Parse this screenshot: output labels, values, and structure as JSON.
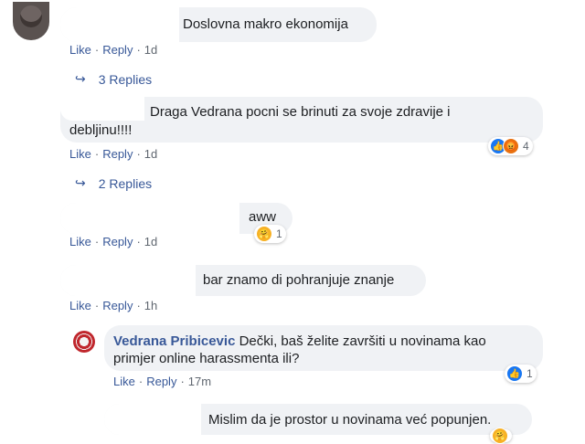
{
  "comments": [
    {
      "text": "Doslovna makro ekonomija",
      "actions": {
        "like": "Like",
        "reply": "Reply",
        "time": "1d"
      },
      "replies_label": "3 Replies"
    },
    {
      "text_line1": "Draga Vedrana pocni se brinuti za svoje zdravije i",
      "text_line2": "debljinu!!!!",
      "reaction_count": "4",
      "actions": {
        "like": "Like",
        "reply": "Reply",
        "time": "1d"
      },
      "replies_label": "2 Replies"
    },
    {
      "text": "aww",
      "reaction_count": "1",
      "actions": {
        "like": "Like",
        "reply": "Reply",
        "time": "1d"
      }
    },
    {
      "text": "bar znamo di pohranjuje znanje",
      "actions": {
        "like": "Like",
        "reply": "Reply",
        "time": "1h"
      }
    },
    {
      "author": "Vedrana Pribicevic",
      "text_line1": "Dečki, baš želite završiti u novinama kao",
      "text_line2": "primjer online harassmenta ili?",
      "reaction_count": "1",
      "actions": {
        "like": "Like",
        "reply": "Reply",
        "time": "17m"
      }
    },
    {
      "text": "Mislim da je prostor u novinama već popunjen."
    }
  ],
  "icons": {
    "reply_arrow": "reply-arrow-icon",
    "like_reaction": "like-reaction-icon",
    "angry_reaction": "angry-reaction-icon",
    "care_reaction": "care-reaction-icon"
  },
  "colors": {
    "link": "#385898",
    "bubble": "#f0f2f5",
    "like_blue": "#1877f2"
  }
}
